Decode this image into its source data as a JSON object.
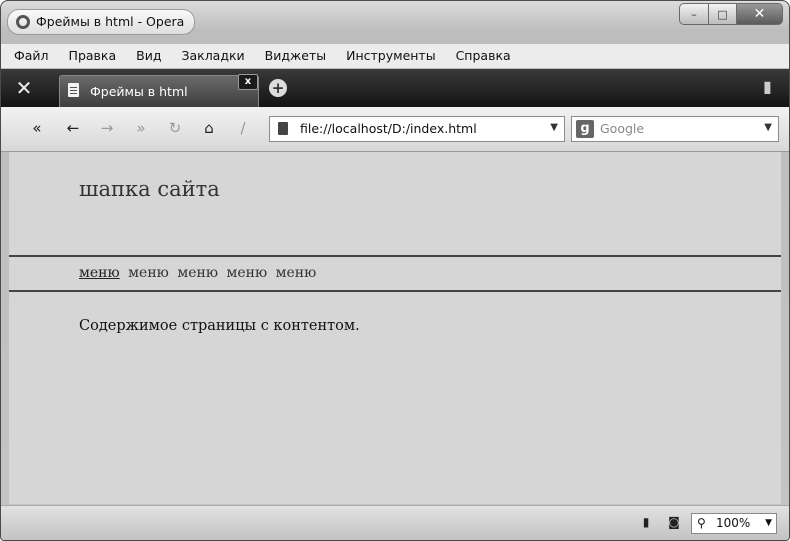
{
  "window": {
    "title": "Фреймы в html - Opera",
    "controls": {
      "minimize": "–",
      "maximize": "□",
      "close": "✕"
    }
  },
  "menubar": [
    "Файл",
    "Правка",
    "Вид",
    "Закладки",
    "Виджеты",
    "Инструменты",
    "Справка"
  ],
  "tabs": {
    "active_label": "Фреймы в html",
    "close": "x",
    "new_tab": "+"
  },
  "toolbar": {
    "rewind": "«",
    "back": "←",
    "forward": "→",
    "fast_forward": "»",
    "reload": "↻",
    "home": "⌂",
    "edit": "/",
    "address": "file://localhost/D:/index.html",
    "address_drop": "▼",
    "search_engine_icon": "g",
    "search_placeholder": "Google",
    "search_drop": "▼"
  },
  "page": {
    "header_title": "шапка сайта",
    "menu_links": [
      "меню",
      "меню",
      "меню",
      "меню",
      "меню"
    ],
    "content": "Содержимое страницы с контентом."
  },
  "statusbar": {
    "zoom": "100%",
    "zoom_drop": "▼"
  },
  "icons": {
    "window": "opera-icon",
    "tools": "wrench-icon",
    "trash": "trash-icon",
    "camera": "camera-icon",
    "magnifier": "magnifier-icon"
  }
}
